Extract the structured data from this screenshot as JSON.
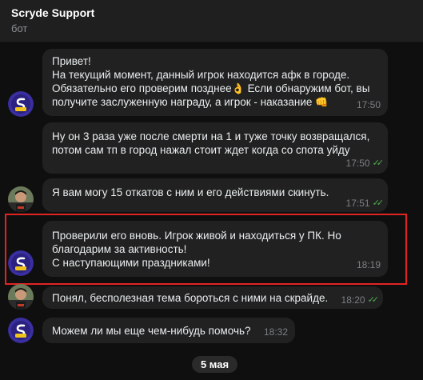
{
  "header": {
    "title": "Scryde Support",
    "subtitle": "бот"
  },
  "messages": [
    {
      "lines": [
        "Привет!",
        "На текущий момент, данный игрок находится афк в городе.",
        "Обязательно его проверим позднее",
        "получите заслуженную награду, а игрок - наказание"
      ],
      "line3_tail": "Если обнаружим бот, вы",
      "emoji1": "👌",
      "emoji2": "👊",
      "time": "17:50"
    },
    {
      "lines": [
        "Ну он 3 раза уже после смерти на 1 и туже точку возвращался,",
        "потом сам тп в город нажал стоит ждет когда со спота уйду"
      ],
      "time": "17:50"
    },
    {
      "lines": [
        "Я вам могу 15 откатов с ним и его действиями скинуть."
      ],
      "time": "17:51"
    },
    {
      "lines": [
        "Проверили его вновь. Игрок живой и находиться у ПК. Но",
        "благодарим за активность!",
        "С наступающими праздниками!"
      ],
      "time": "18:19"
    },
    {
      "lines": [
        "Понял, бесполезная тема бороться с ними на скрайде."
      ],
      "time": "18:20"
    },
    {
      "lines": [
        "Можем ли мы еще чем-нибудь помочь?"
      ],
      "time": "18:32"
    }
  ],
  "date_separator": "5 мая",
  "colors": {
    "accent_check": "#4fae4e",
    "highlight": "#e12323",
    "bubble": "#212121",
    "background": "#0f0f0f"
  },
  "icons": {
    "bot_avatar": "scryde-logo-icon",
    "user_avatar": "user-photo-avatar",
    "read_status": "double-check-icon"
  }
}
